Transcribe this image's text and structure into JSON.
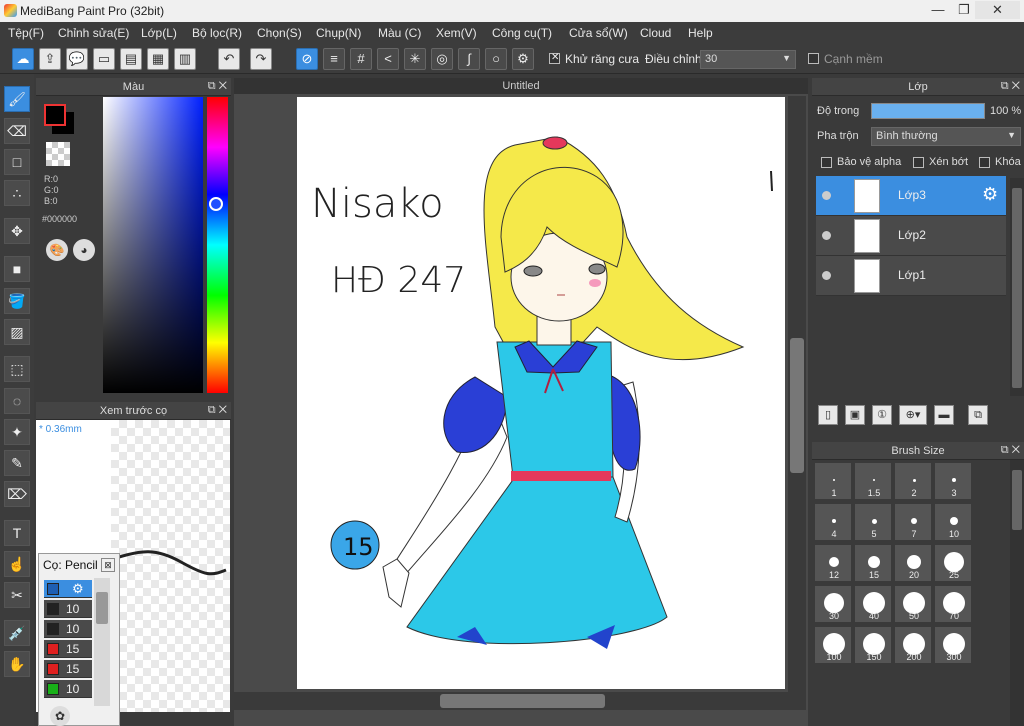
{
  "window": {
    "title": "MediBang Paint Pro (32bit)",
    "minimize": "—",
    "maximize": "❐",
    "close": "✕"
  },
  "menu": [
    "Tệp(F)",
    "Chỉnh sửa(E)",
    "Lớp(L)",
    "Bộ lọc(R)",
    "Chọn(S)",
    "Chụp(N)",
    "Màu (C)",
    "Xem(V)",
    "Công cụ(T)",
    "Cửa sổ(W)",
    "Cloud",
    "Help"
  ],
  "toolbar": {
    "antialias_label": "Khử răng cưa",
    "antialias_checked": true,
    "adjust_label": "Điều chỉnh",
    "adjust_value": "30",
    "smooth_label": "Cạnh mềm",
    "smooth_checked": false
  },
  "color_panel": {
    "title": "Màu",
    "foreground": "#000000",
    "r": "R:0",
    "g": "G:0",
    "b": "B:0",
    "hex": "#000000"
  },
  "brush_preview": {
    "title": "Xem trước cọ",
    "size": "* 0.36mm"
  },
  "brush_popup": {
    "title": "Cọ: Pencil",
    "rows": [
      {
        "color": "#1e5fb3",
        "size": ""
      },
      {
        "color": "#222222",
        "size": "10"
      },
      {
        "color": "#222222",
        "size": "10"
      },
      {
        "color": "#e02020",
        "size": "15"
      },
      {
        "color": "#e02020",
        "size": "15"
      },
      {
        "color": "#18b018",
        "size": "10"
      }
    ]
  },
  "canvas": {
    "tab": "Untitled",
    "text1": "Nisako",
    "text2": "HĐ 247",
    "badge": "15"
  },
  "layer_panel": {
    "title": "Lớp",
    "opacity_label": "Độ trong",
    "opacity_value": "100 %",
    "opacity_fraction": 1.0,
    "blend_label": "Pha trộn",
    "blend_value": "Bình thường",
    "protect_alpha": "Bảo vệ alpha",
    "clip": "Xén bớt",
    "lock": "Khóa",
    "layers": [
      {
        "name": "Lớp3",
        "selected": true
      },
      {
        "name": "Lớp2",
        "selected": false
      },
      {
        "name": "Lớp1",
        "selected": false
      }
    ]
  },
  "brush_size_panel": {
    "title": "Brush Size",
    "sizes": [
      "1",
      "1.5",
      "2",
      "3",
      "4",
      "5",
      "7",
      "10",
      "12",
      "15",
      "20",
      "25",
      "30",
      "40",
      "50",
      "70",
      "100",
      "150",
      "200",
      "300"
    ]
  }
}
